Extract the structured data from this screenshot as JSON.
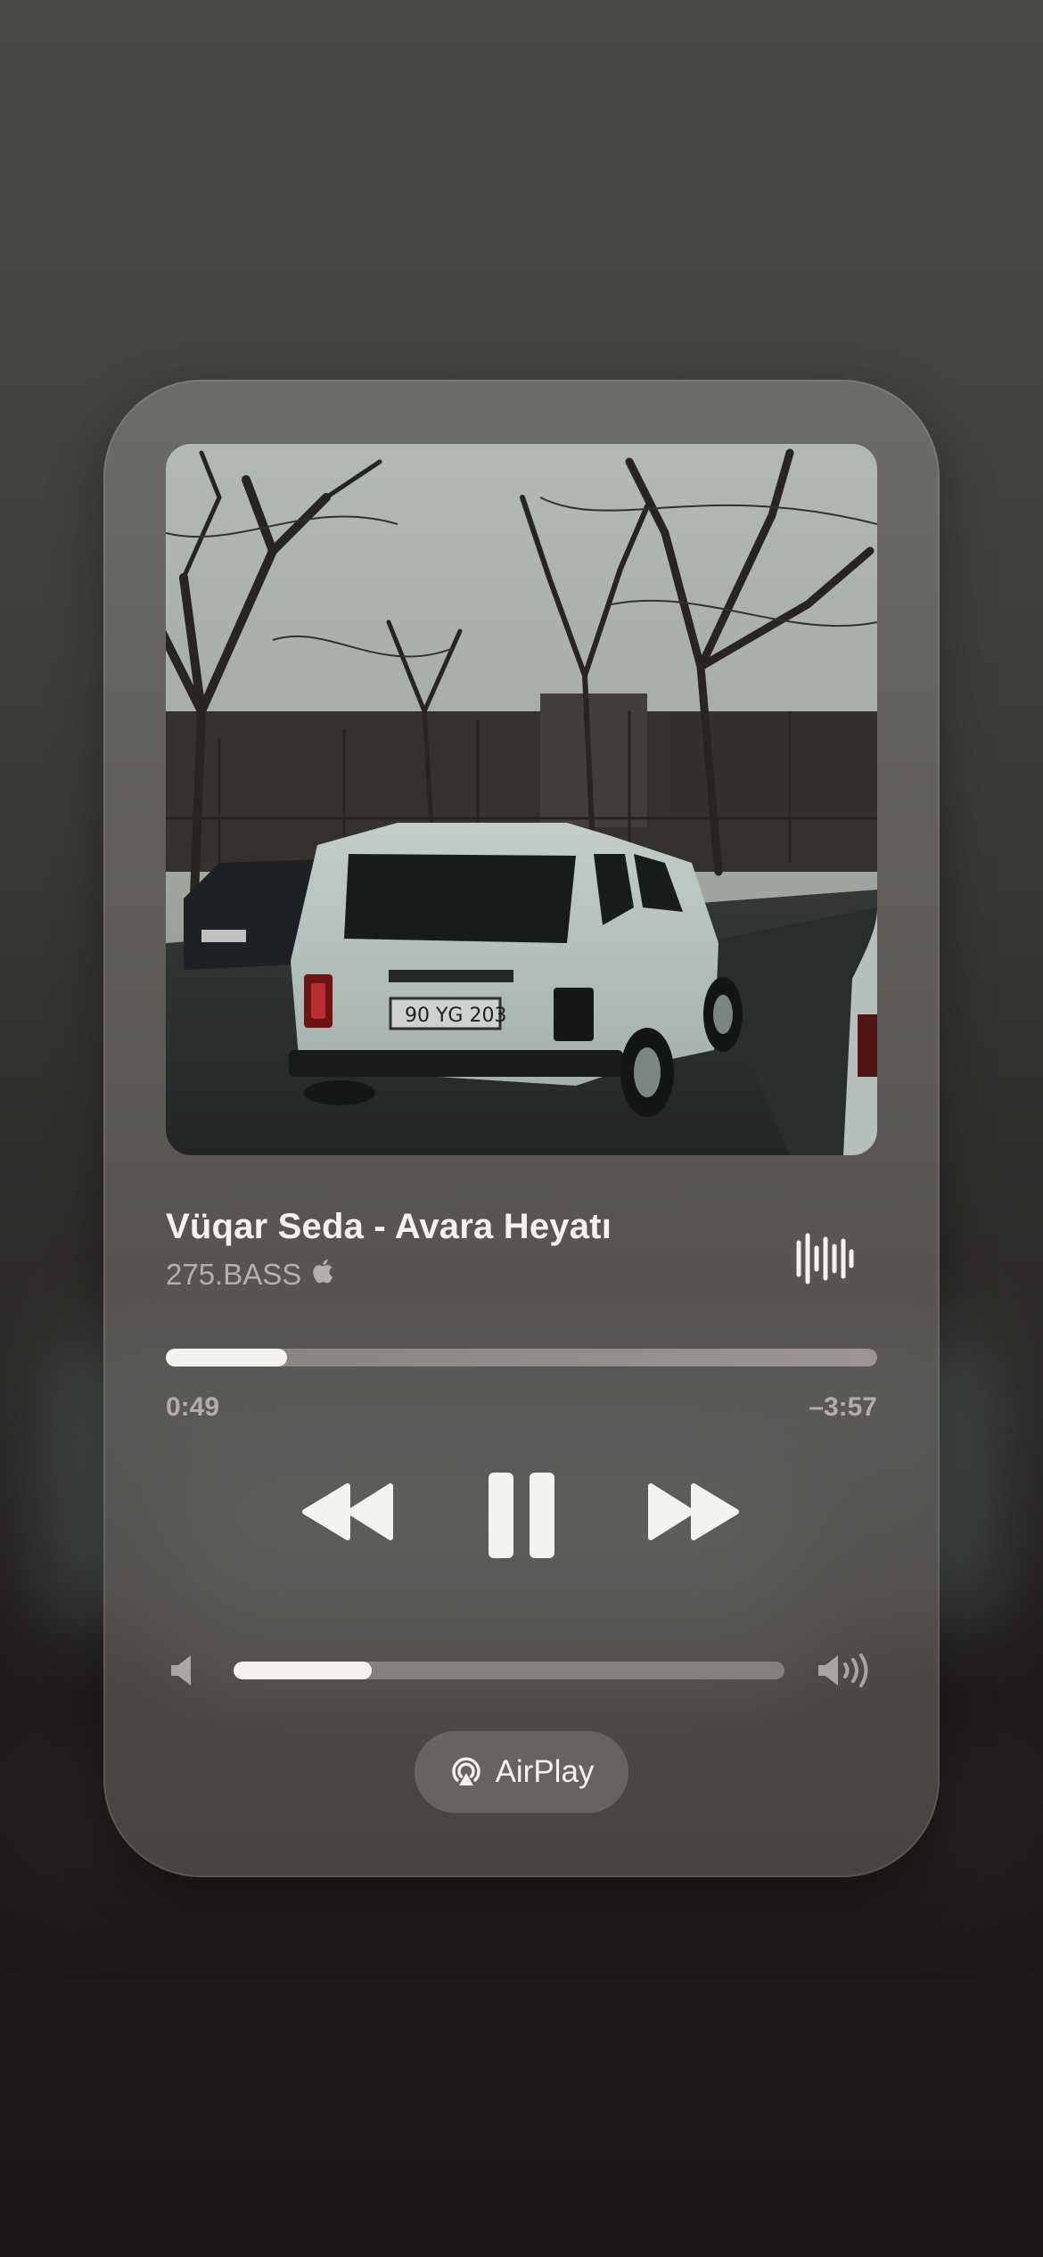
{
  "now_playing": {
    "title": "Vüqar Seda - Avara Heyatı",
    "artist": "275.BASS",
    "artist_badge_icon": "apple-icon",
    "playing_indicator_icon": "waveform-icon"
  },
  "playback": {
    "elapsed": "0:49",
    "remaining": "–3:57",
    "progress_fraction": 0.17
  },
  "controls": {
    "previous_icon": "rewind-icon",
    "play_pause_icon": "pause-icon",
    "next_icon": "fast-forward-icon"
  },
  "volume": {
    "level_fraction": 0.25,
    "low_icon": "speaker-low-icon",
    "high_icon": "speaker-high-icon"
  },
  "airplay": {
    "label": "AirPlay",
    "icon": "airplay-icon"
  },
  "colors": {
    "primary_text": "#f4f2ef",
    "secondary_text": "#b3afab"
  }
}
